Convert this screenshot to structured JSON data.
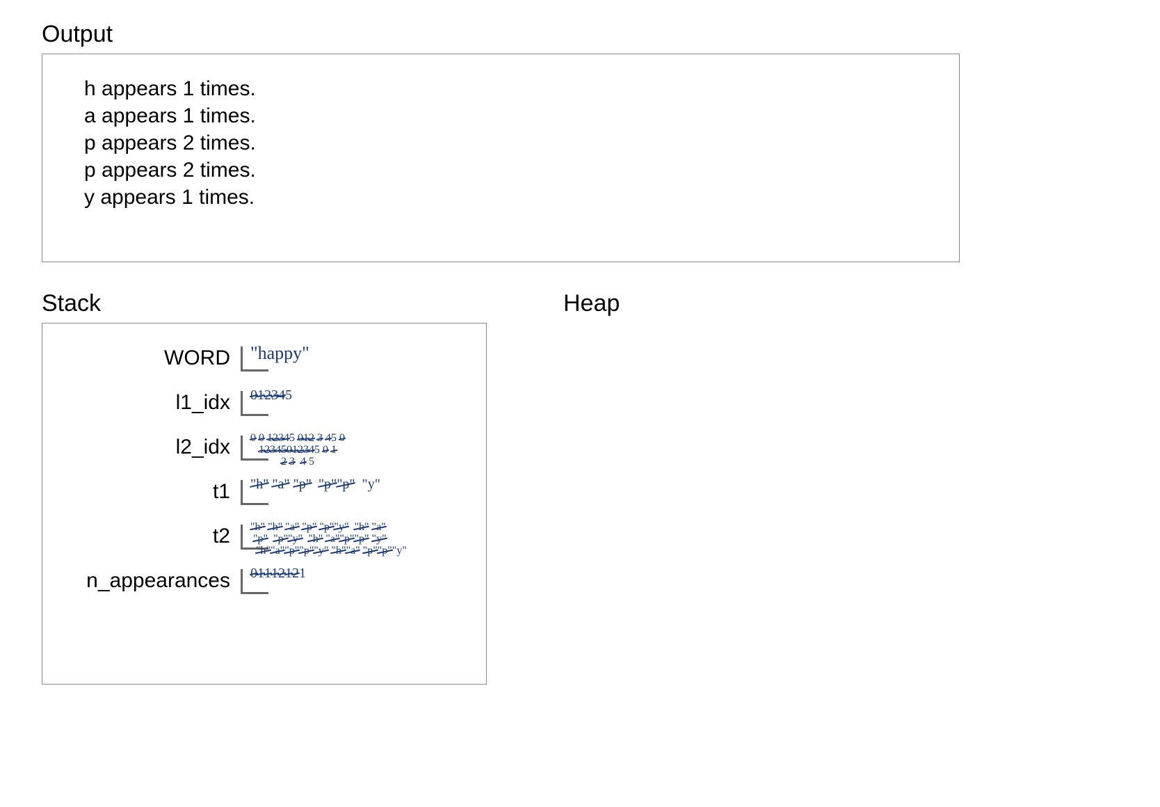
{
  "output": {
    "title": "Output",
    "lines": [
      "h appears 1 times.",
      "a appears 1 times.",
      "p appears 2 times.",
      "p appears 2 times.",
      "y appears 1 times."
    ]
  },
  "stack": {
    "title": "Stack",
    "rows": [
      {
        "label": "WORD",
        "value": "\"happy\"",
        "size": "normal"
      },
      {
        "label": "l1_idx",
        "value_html": "<span class='strike'>0</span><span class='strike'>1</span><span class='strike'>2</span><span class='strike'>3</span><span class='strike'>4</span>5",
        "size": "small"
      },
      {
        "label": "l2_idx",
        "value_html": "<span class='strike'>0</span> <span class='strike'>0</span> <span class='strike'>1</span><span class='strike'>2</span><span class='strike'>3</span><span class='strike'>4</span>5 <span class='strike'>0</span><span class='strike'>1</span><span class='strike'>2</span> <span class='strike'>3</span> <span class='strike'>4</span>5 <span class='strike'>0</span><br>&nbsp;&nbsp;&nbsp;<span class='strike'>1</span><span class='strike'>2</span><span class='strike'>3</span><span class='strike'>4</span><span class='strike'>5</span><span class='strike'>0</span><span class='strike'>1</span><span class='strike'>2</span><span class='strike'>3</span><span class='strike'>4</span>5 <span class='strike'>0</span> <span class='strike'>1</span><br>&nbsp;&nbsp;&nbsp;&nbsp;&nbsp;&nbsp;&nbsp;&nbsp;&nbsp;&nbsp;&nbsp;<span class='strike'>2</span> <span class='strike'>3</span>&nbsp; <span class='strike'>4</span> 5",
        "size": "tiny"
      },
      {
        "label": "t1",
        "value_html": "<span class='strike'>\"h\"</span> <span class='strike'>\"a\"</span> <span class='strike'>\"p\"</span>&nbsp; <span class='strike'>\"p\"</span><span class='strike'>\"p\"</span>&nbsp; \"y\"",
        "size": "small"
      },
      {
        "label": "t2",
        "value_html": "<span class='strike'>\"h\"</span> <span class='strike'>\"h\"</span> <span class='strike'>\"a\"</span> <span class='strike'>\"p\"</span> <span class='strike'>\"p\"</span><span class='strike'>\"y\"</span> &nbsp;<span class='strike'>\"h\"</span> <span class='strike'>\"a\"</span><br>&nbsp;<span class='strike'>\"p\"</span>&nbsp; <span class='strike'>\"p\"</span><span class='strike'>\"y\"</span>&nbsp; <span class='strike'>\"h\"</span> <span class='strike'>\"a\"</span><span class='strike'>\"p\"</span><span class='strike'>\"p\"</span> <span class='strike'>\"y\"</span><br>&nbsp;&nbsp;<span class='strike'>\"h\"</span><span class='strike'>\"a\"</span><span class='strike'>\"p\"</span><span class='strike'>\"p\"</span><span class='strike'>\"y\"</span> <span class='strike'>\"h\"</span><span class='strike'>\"a\"</span> <span class='strike'>\"p\"</span><span class='strike'>\"p\"</span>\"y\"",
        "size": "tiny"
      },
      {
        "label": "n_appearances",
        "value_html": "<span class='strike'>0</span><span class='strike'>1</span><span class='strike'>1</span><span class='strike'>1</span><span class='strike'>2</span><span class='strike'>1</span><span class='strike'>2</span>1",
        "size": "small"
      }
    ]
  },
  "heap": {
    "title": "Heap"
  }
}
